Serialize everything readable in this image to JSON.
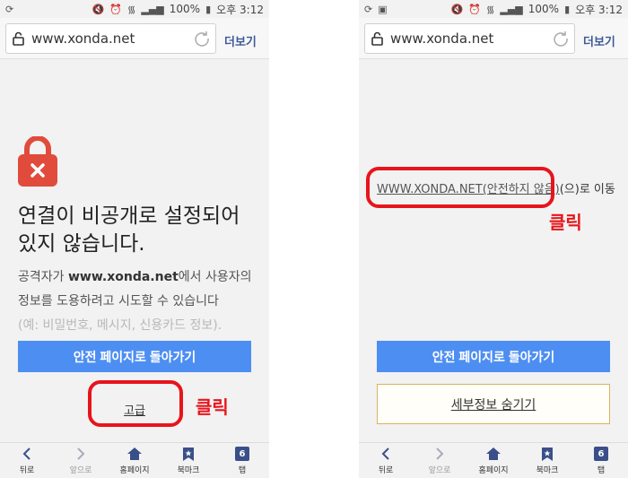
{
  "status_bar": {
    "battery": "100%",
    "time": "오후 3:12"
  },
  "url_bar": {
    "url": "www.xonda.net",
    "more_label": "더보기"
  },
  "left_screen": {
    "title": "연결이 비공개로 설정되어 있지 않습니다.",
    "desc_prefix": "공격자가 ",
    "desc_domain": "www.xonda.net",
    "desc_suffix": "에서 사용자의 정보를 도용하려고 시도할 수 있습니다",
    "desc_faded": "(예: 비밀번호, 메시지, 신용카드 정보).",
    "back_to_safety": "안전 페이지로 돌아가기",
    "advanced": "고급",
    "click_note": "클릭"
  },
  "right_screen": {
    "proceed_link": "WWW.XONDA.NET(안전하지 않음)",
    "proceed_suffix": "(으)로 이동",
    "click_note": "클릭",
    "back_to_safety": "안전 페이지로 돌아가기",
    "hide_details": "세부정보 숨기기"
  },
  "bottom_nav": {
    "back": "뒤로",
    "forward": "앞으로",
    "home": "홈페이지",
    "bookmarks": "북마크",
    "tabs": "탭",
    "tab_count": "6"
  },
  "colors": {
    "accent_blue": "#4d8ef2",
    "annotation_red": "#e8141c",
    "lock_red": "#e04b3c",
    "nav_blue": "#3a4f8a"
  }
}
